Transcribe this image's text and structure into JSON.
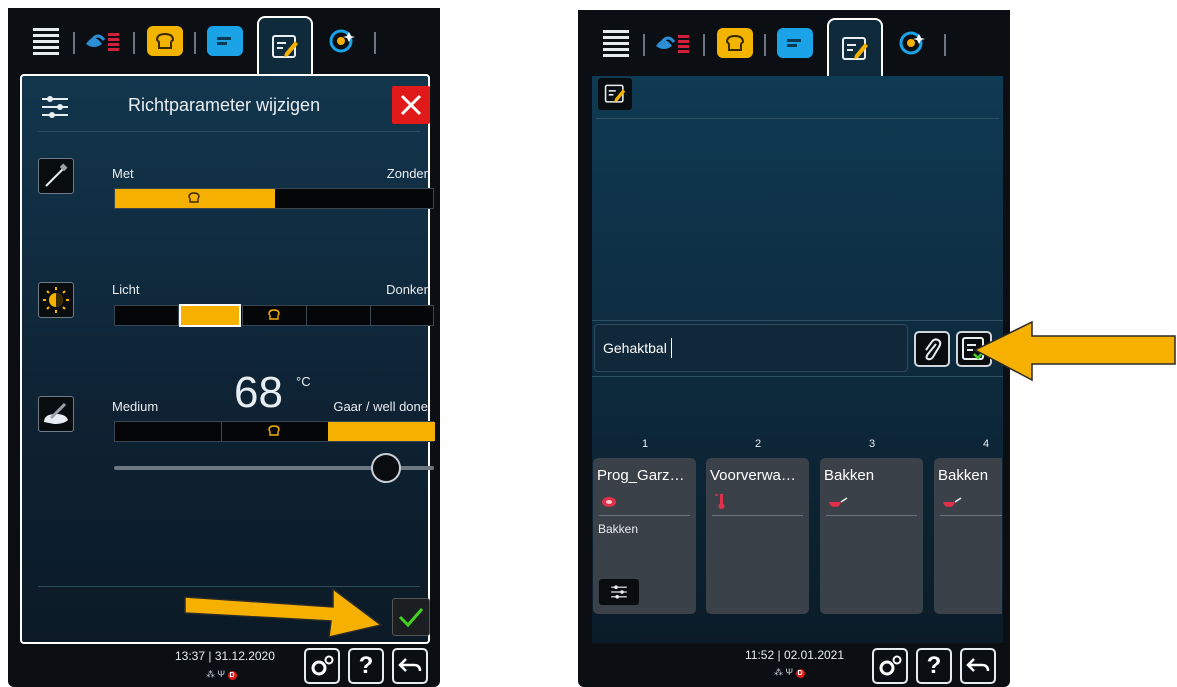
{
  "left_screen": {
    "title": "Richtparameter wijzigen",
    "params": [
      {
        "left": "Met",
        "right": "Zonder",
        "level": "Met"
      },
      {
        "left": "Licht",
        "right": "Donker",
        "level": 2
      },
      {
        "left": "Medium",
        "right": "Gaar / well done",
        "level": 3,
        "temperature": "68",
        "unit": "°C",
        "slider": 0.85
      }
    ],
    "status": {
      "time": "13:37",
      "separator": "|",
      "date": "31.12.2020",
      "badge": "D",
      "help_label": "?"
    }
  },
  "right_screen": {
    "name_field": "Gehaktbal",
    "steps": [
      {
        "number": "1",
        "title": "Prog_Garz…",
        "icon": "meat-icon",
        "subtitle": "Bakken"
      },
      {
        "number": "2",
        "title": "Voorverwa…",
        "icon": "thermometer-icon",
        "subtitle": ""
      },
      {
        "number": "3",
        "title": "Bakken",
        "icon": "pan-icon",
        "subtitle": ""
      },
      {
        "number": "4",
        "title": "Bakken",
        "icon": "pan-icon",
        "subtitle": ""
      }
    ],
    "status": {
      "time": "11:52",
      "separator": "|",
      "date": "02.01.2021",
      "badge": "D",
      "help_label": "?"
    }
  },
  "colors": {
    "accent": "#f6b100",
    "panel": "#0f2a3b",
    "close": "#e01919",
    "confirm": "#44d11f"
  }
}
